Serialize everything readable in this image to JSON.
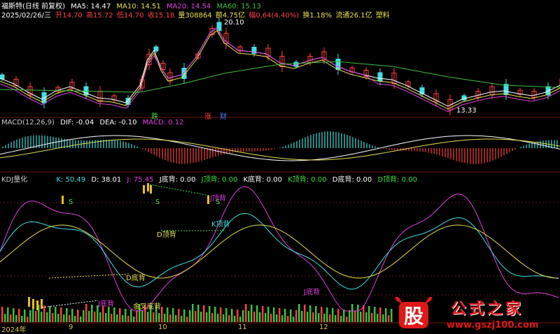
{
  "header": {
    "stock_name": "福斯特(日线 前复权)",
    "ma5": "MA5: 14.47",
    "ma10": "MA10: 14.51",
    "ma20": "MA20: 14.54",
    "ma60": "MA60: 15.13",
    "date": "2025/02/26/三",
    "open": "开14.70",
    "high": "高15.72",
    "low": "低14.70",
    "close": "收15.18",
    "volume": "量308864",
    "amount": "额4.75亿",
    "change": "幅0.64(4.40%)",
    "turnover": "换1.18%",
    "float": "流通26.1亿",
    "sector": "塑料"
  },
  "price_labels": {
    "high_mark": "20.10",
    "low_mark": "13.33",
    "event_1": "跌",
    "event_2": "涨",
    "event_3": "财"
  },
  "macd": {
    "title": "MACD(12,26,9)",
    "dif": "DIF: -0.04",
    "dea": "DEA: -0.10",
    "macd": "MACD: 0.12"
  },
  "kdj": {
    "title": "KDJ量化",
    "k": "K: 50.49",
    "d": "D: 38.01",
    "j": "J: 75.45",
    "j_bottom": "J底背: 0.00",
    "j_top": "J顶背: 0.00",
    "k_bottom": "K底背: 0.00",
    "k_top": "K顶背: 0.00",
    "d_bottom": "D底背: 0.00",
    "d_top": "D顶背: 0.00"
  },
  "kdj_labels": {
    "s1": "S",
    "s2": "S",
    "s3": "S",
    "top_div_1": "J顶背",
    "top_div_2": "K顶背",
    "top_div_3": "D顶背",
    "bottom_div_1": "D底背",
    "bottom_div_2": "J底背",
    "bottom_div_3": "J底背",
    "golden_cross": "金叉底背"
  },
  "xaxis": {
    "labels": [
      "2024年",
      "9",
      "10",
      "11",
      "12"
    ]
  },
  "watermark": {
    "logo_char": "股",
    "title": "公式之家",
    "url": "www.gszj100.com"
  },
  "colors": {
    "ma5": "#ffffff",
    "ma10": "#e8e050",
    "ma20": "#e040e0",
    "ma60": "#40c040",
    "up": "#ff4040",
    "down": "#40e0e0",
    "k_line": "#ffffff",
    "d_line": "#e8e050",
    "j_line": "#e040e0"
  }
}
